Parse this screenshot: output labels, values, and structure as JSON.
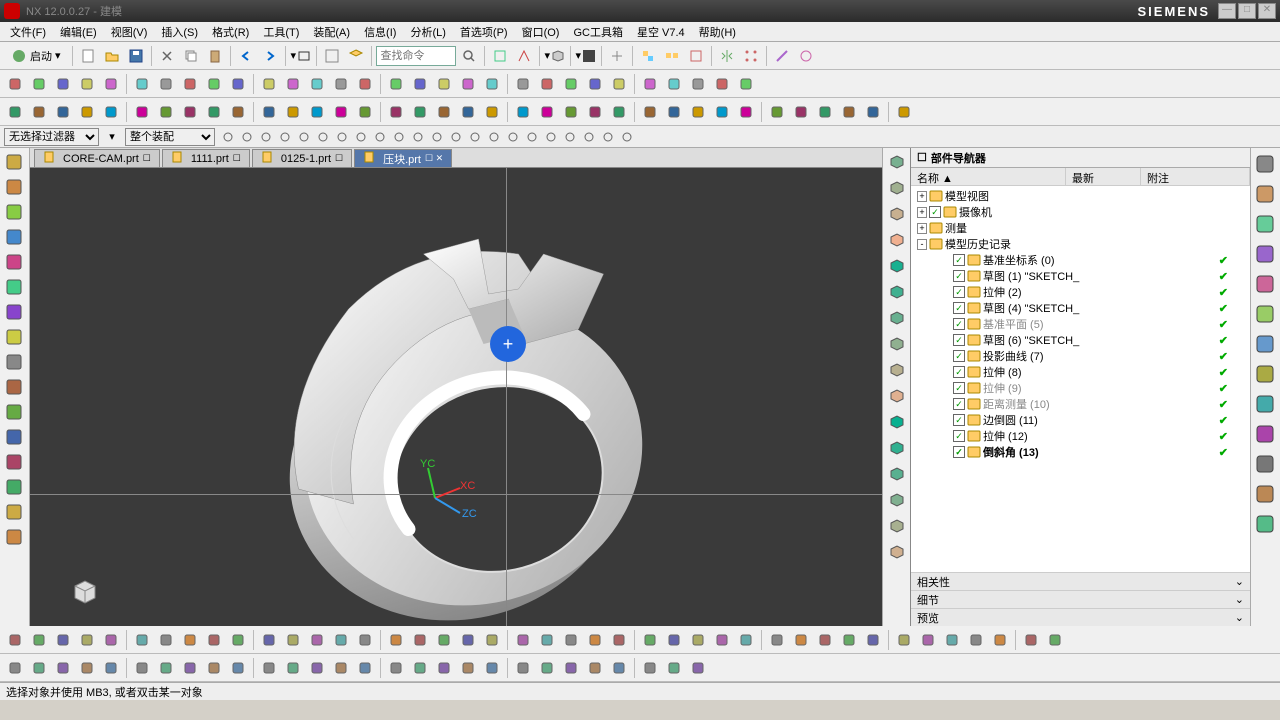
{
  "title": "NX 12.0.0.27 - 建模",
  "brand": "SIEMENS",
  "menu": [
    "文件(F)",
    "编辑(E)",
    "视图(V)",
    "插入(S)",
    "格式(R)",
    "工具(T)",
    "装配(A)",
    "信息(I)",
    "分析(L)",
    "首选项(P)",
    "窗口(O)",
    "GC工具箱",
    "星空 V7.4",
    "帮助(H)"
  ],
  "start_label": "启动",
  "search_placeholder": "查找命令",
  "filter1": "无选择过滤器",
  "filter2": "整个装配",
  "tabs": [
    {
      "label": "CORE-CAM.prt",
      "active": false
    },
    {
      "label": "1111.prt",
      "active": false
    },
    {
      "label": "0125-1.prt",
      "active": false
    },
    {
      "label": "压块.prt",
      "active": true
    }
  ],
  "nav": {
    "title": "部件导航器",
    "cols": [
      "名称 ▲",
      "最新",
      "附注"
    ],
    "tree": [
      {
        "indent": 0,
        "exp": "+",
        "icon": "folder",
        "label": "模型视图"
      },
      {
        "indent": 0,
        "exp": "+",
        "check": true,
        "icon": "camera",
        "label": "摄像机"
      },
      {
        "indent": 0,
        "exp": "+",
        "icon": "ruler",
        "label": "测量"
      },
      {
        "indent": 0,
        "exp": "-",
        "icon": "folder-o",
        "label": "模型历史记录"
      },
      {
        "indent": 1,
        "check": true,
        "icon": "csys",
        "label": "基准坐标系 (0)",
        "ok": true
      },
      {
        "indent": 1,
        "check": true,
        "icon": "sketch",
        "label": "草图 (1) \"SKETCH_",
        "ok": true
      },
      {
        "indent": 1,
        "check": true,
        "icon": "extrude",
        "label": "拉伸 (2)",
        "ok": true
      },
      {
        "indent": 1,
        "check": true,
        "icon": "sketch",
        "label": "草图 (4) \"SKETCH_",
        "ok": true
      },
      {
        "indent": 1,
        "check": true,
        "icon": "plane",
        "label": "基准平面 (5)",
        "ok": true
      },
      {
        "indent": 1,
        "check": true,
        "icon": "sketch",
        "label": "草图 (6) \"SKETCH_",
        "ok": true
      },
      {
        "indent": 1,
        "check": true,
        "icon": "curve",
        "label": "投影曲线 (7)",
        "ok": true
      },
      {
        "indent": 1,
        "check": true,
        "icon": "extrude",
        "label": "拉伸 (8)",
        "ok": true
      },
      {
        "indent": 1,
        "check": true,
        "icon": "extrude",
        "label": "拉伸 (9)",
        "ok": true
      },
      {
        "indent": 1,
        "check": true,
        "icon": "measure",
        "label": "距离测量 (10)",
        "ok": true
      },
      {
        "indent": 1,
        "check": true,
        "icon": "blend",
        "label": "边倒圆 (11)",
        "ok": true
      },
      {
        "indent": 1,
        "check": true,
        "icon": "extrude",
        "label": "拉伸 (12)",
        "ok": true
      },
      {
        "indent": 1,
        "check": true,
        "icon": "chamfer",
        "label": "倒斜角 (13)",
        "ok": true,
        "bold": true
      }
    ],
    "sections": [
      "相关性",
      "细节",
      "预览"
    ]
  },
  "status": "选择对象并使用 MB3, 或者双击某一对象",
  "triad": {
    "x": "XC",
    "y": "YC",
    "z": "ZC"
  }
}
